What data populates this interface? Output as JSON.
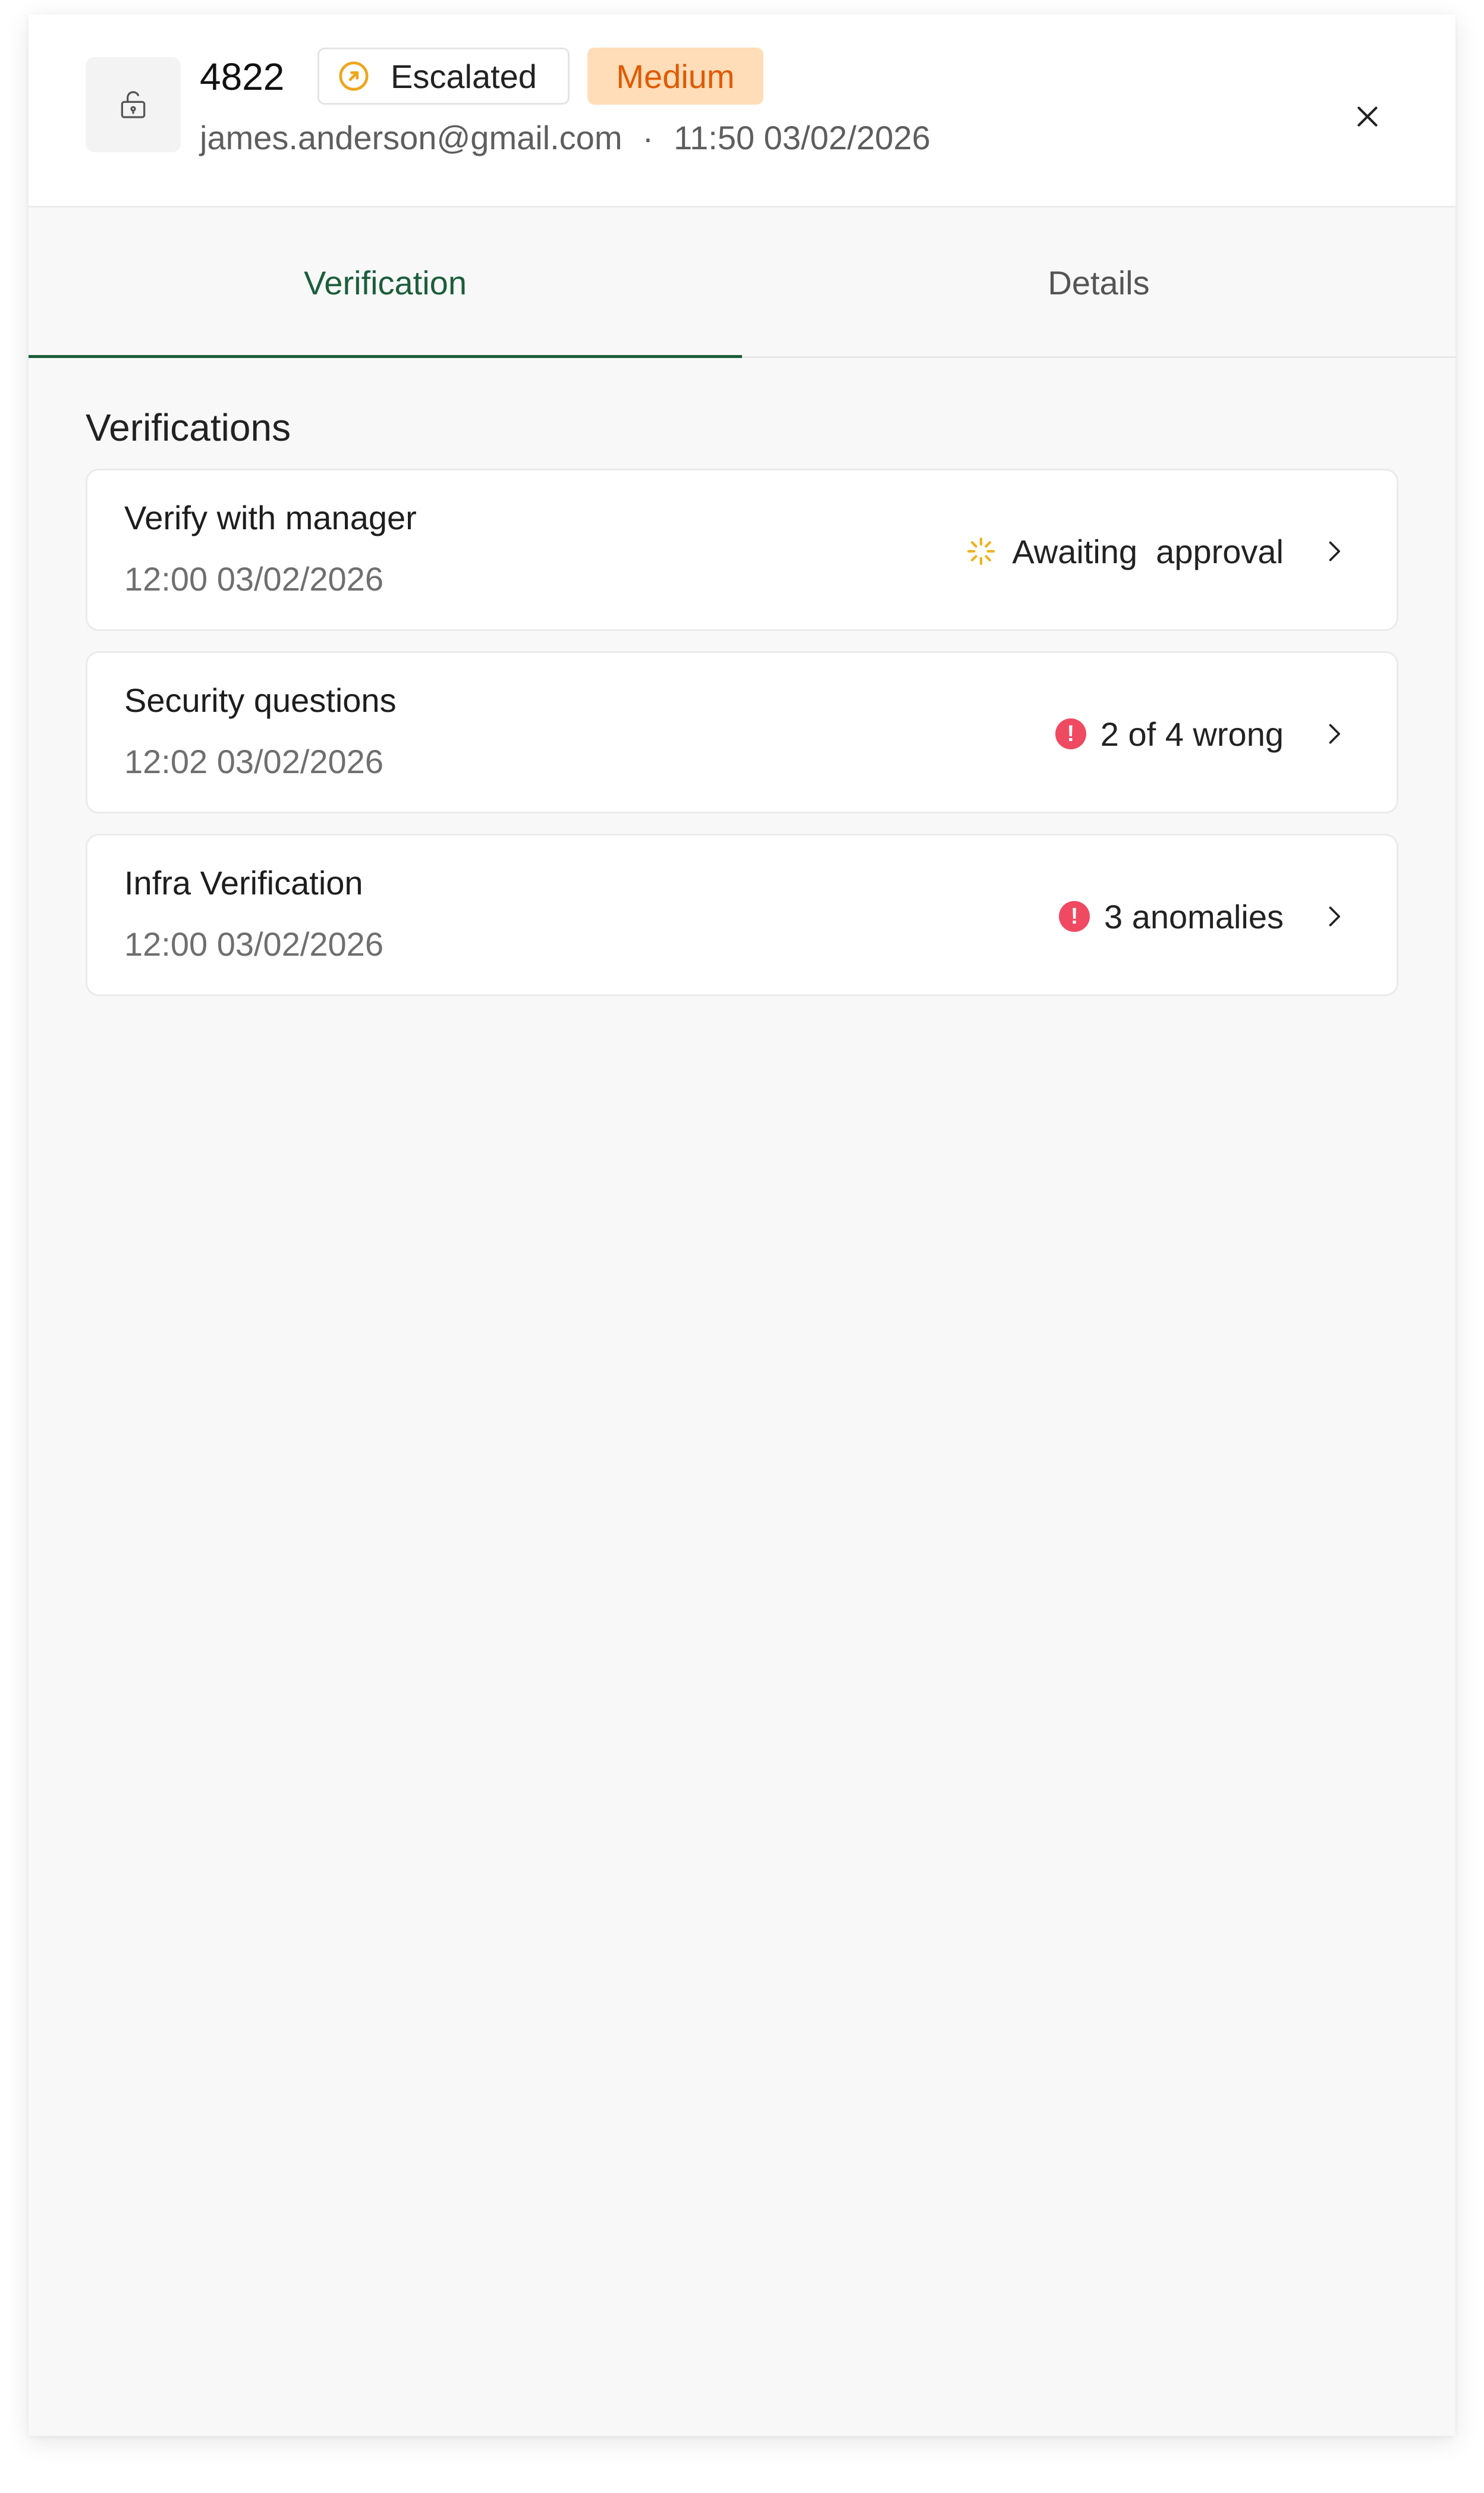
{
  "header": {
    "ticket_id": "4822",
    "status_badge": "Escalated",
    "priority_badge": "Medium",
    "email": "james.anderson@gmail.com",
    "separator": "·",
    "timestamp": "11:50 03/02/2026"
  },
  "tabs": [
    {
      "label": "Verification",
      "active": true
    },
    {
      "label": "Details",
      "active": false
    }
  ],
  "section_title": "Verifications",
  "verifications": [
    {
      "title": "Verify with manager",
      "time": "12:00 03/02/2026",
      "status": "Awaiting  approval",
      "status_icon": "loading-spinner-icon"
    },
    {
      "title": "Security questions",
      "time": "12:02 03/02/2026",
      "status": "2 of 4 wrong",
      "status_icon": "error-icon"
    },
    {
      "title": "Infra Verification",
      "time": "12:00 03/02/2026",
      "status": "3 anomalies",
      "status_icon": "error-icon"
    }
  ],
  "colors": {
    "accent": "#1b5e3a",
    "escalated": "#f0a51c",
    "priority_bg": "#ffddb8",
    "priority_text": "#e05a00",
    "error": "#f04a62",
    "pending": "#f0b21c"
  }
}
